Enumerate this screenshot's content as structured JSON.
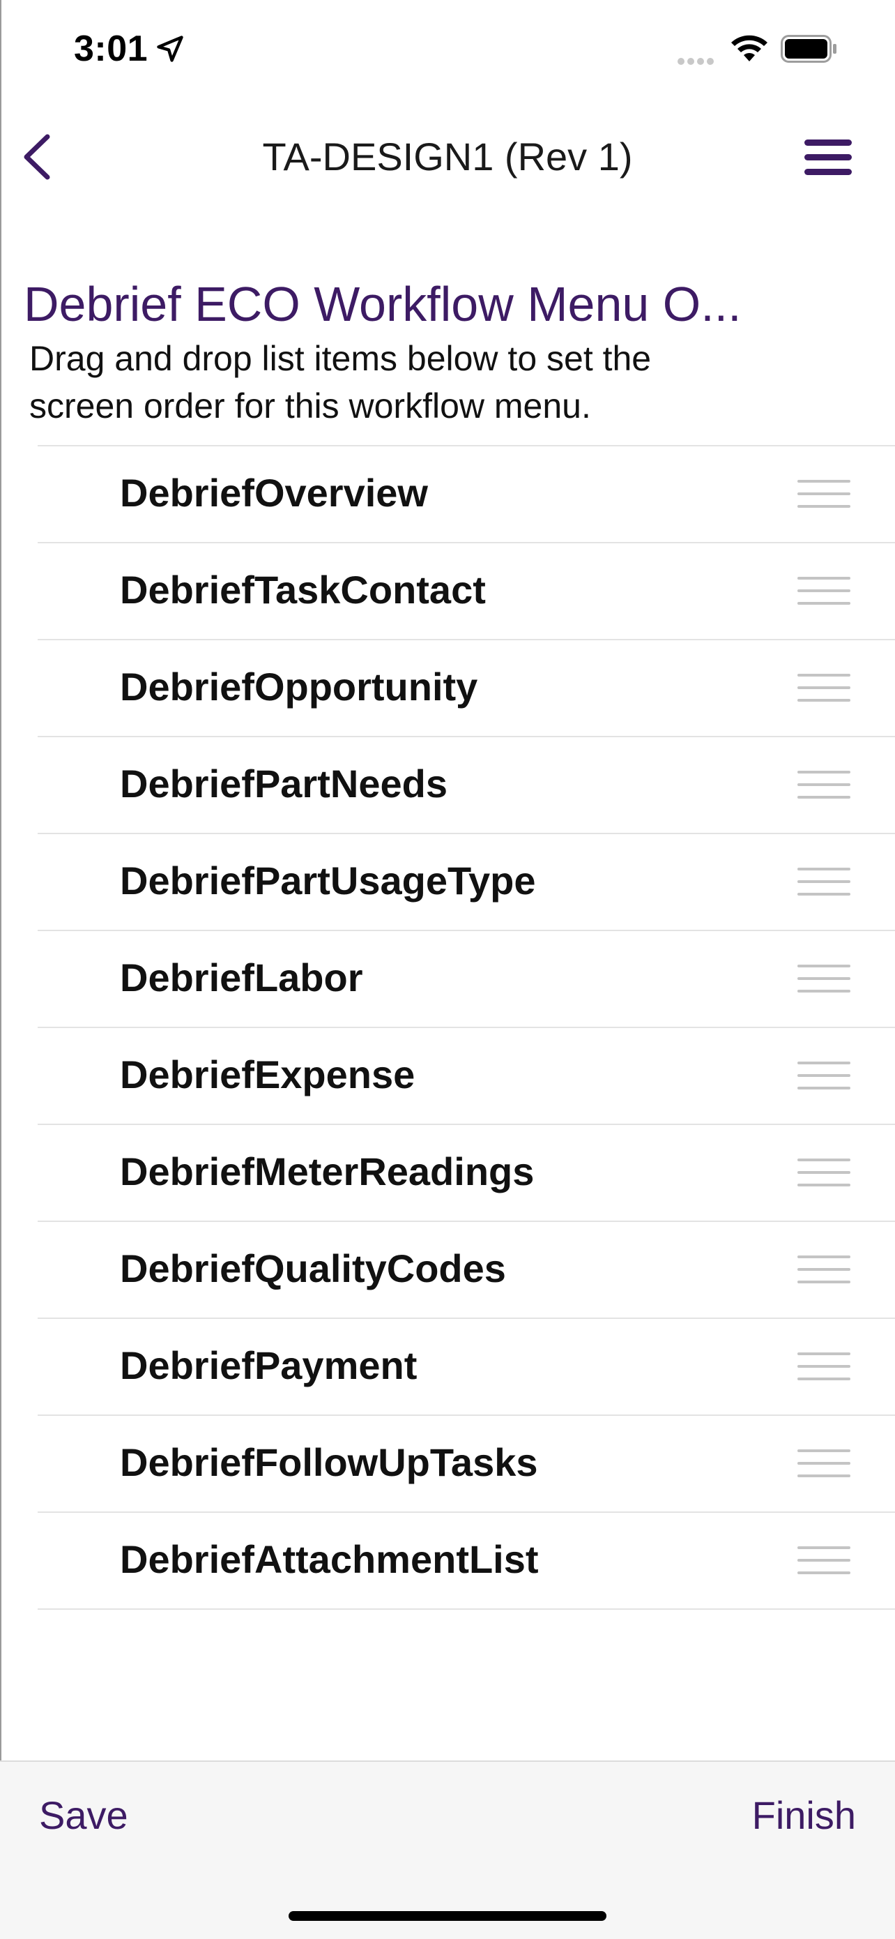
{
  "status_bar": {
    "time": "3:01",
    "location_icon": "location-arrow-icon",
    "signal_icon": "cellular-signal-icon",
    "wifi_icon": "wifi-icon",
    "battery_icon": "battery-icon"
  },
  "nav": {
    "title": "TA-DESIGN1 (Rev 1)",
    "back_icon": "chevron-left-icon",
    "menu_icon": "hamburger-menu-icon"
  },
  "header": {
    "title": "Debrief ECO Workflow Menu O...",
    "instructions": "Drag and drop list items below to set the screen order for this workflow menu."
  },
  "list": {
    "items": [
      {
        "label": "DebriefOverview"
      },
      {
        "label": "DebriefTaskContact"
      },
      {
        "label": "DebriefOpportunity"
      },
      {
        "label": "DebriefPartNeeds"
      },
      {
        "label": "DebriefPartUsageType"
      },
      {
        "label": "DebriefLabor"
      },
      {
        "label": "DebriefExpense"
      },
      {
        "label": "DebriefMeterReadings"
      },
      {
        "label": "DebriefQualityCodes"
      },
      {
        "label": "DebriefPayment"
      },
      {
        "label": "DebriefFollowUpTasks"
      },
      {
        "label": "DebriefAttachmentList"
      }
    ],
    "handle_icon": "drag-handle-icon"
  },
  "toolbar": {
    "save_label": "Save",
    "finish_label": "Finish"
  },
  "colors": {
    "accent": "#3d1b64",
    "divider": "#e3e3e3",
    "handle": "#c4c4c4",
    "toolbar_bg": "#f6f6f6"
  }
}
